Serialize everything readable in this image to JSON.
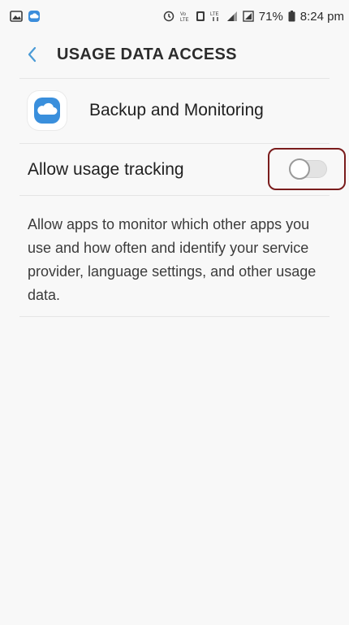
{
  "status_bar": {
    "left_icons": [
      "gallery-icon",
      "cloud-icon"
    ],
    "right_icons": [
      "alarm-icon",
      "volte-icon",
      "nfc-icon",
      "lte-icon",
      "signal-icon",
      "sim-icon"
    ],
    "battery_percent": "71%",
    "time": "8:24 pm"
  },
  "header": {
    "title": "USAGE DATA ACCESS",
    "back_icon": "chevron-left-icon"
  },
  "app": {
    "name": "Backup and Monitoring",
    "icon": "cloud-icon"
  },
  "toggle": {
    "label": "Allow usage tracking",
    "state": "off"
  },
  "description": "Allow apps to monitor which other apps you use and how often and identify your service provider, language settings, and other usage data.",
  "colors": {
    "accent": "#4a9bd6",
    "background": "#f8f8f8",
    "highlight": "#7a1c1c"
  }
}
